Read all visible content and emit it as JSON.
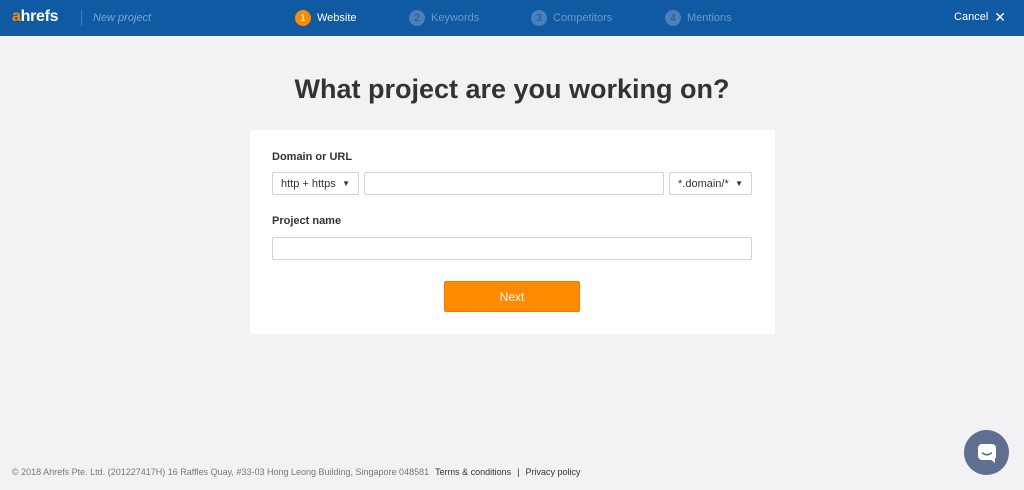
{
  "header": {
    "logo_prefix": "a",
    "logo_rest": "hrefs",
    "project_placeholder": "New project",
    "steps": [
      {
        "number": "1",
        "label": "Website",
        "state": "active"
      },
      {
        "number": "2",
        "label": "Keywords",
        "state": "inactive"
      },
      {
        "number": "3",
        "label": "Competitors",
        "state": "inactive"
      },
      {
        "number": "4",
        "label": "Mentions",
        "state": "inactive"
      }
    ],
    "cancel_label": "Cancel",
    "cancel_icon": "close-icon"
  },
  "main": {
    "title": "What project are you working on?",
    "form": {
      "domain_label": "Domain or URL",
      "protocol_value": "http + https",
      "url_value": "",
      "scope_value": "*.domain/*",
      "project_name_label": "Project name",
      "project_name_value": "",
      "next_label": "Next"
    }
  },
  "footer": {
    "copyright": "© 2018 Ahrefs Pte. Ltd. (201227417H) 16 Raffles Quay, #33-03 Hong Leong Building, Singapore 048581",
    "terms_label": "Terms & conditions",
    "separator": "|",
    "privacy_label": "Privacy policy"
  },
  "chat_widget": {
    "icon": "chat-icon"
  },
  "colors": {
    "header_bg": "#0f5aa3",
    "accent": "#ff8a00",
    "page_bg": "#f2f2f4"
  }
}
